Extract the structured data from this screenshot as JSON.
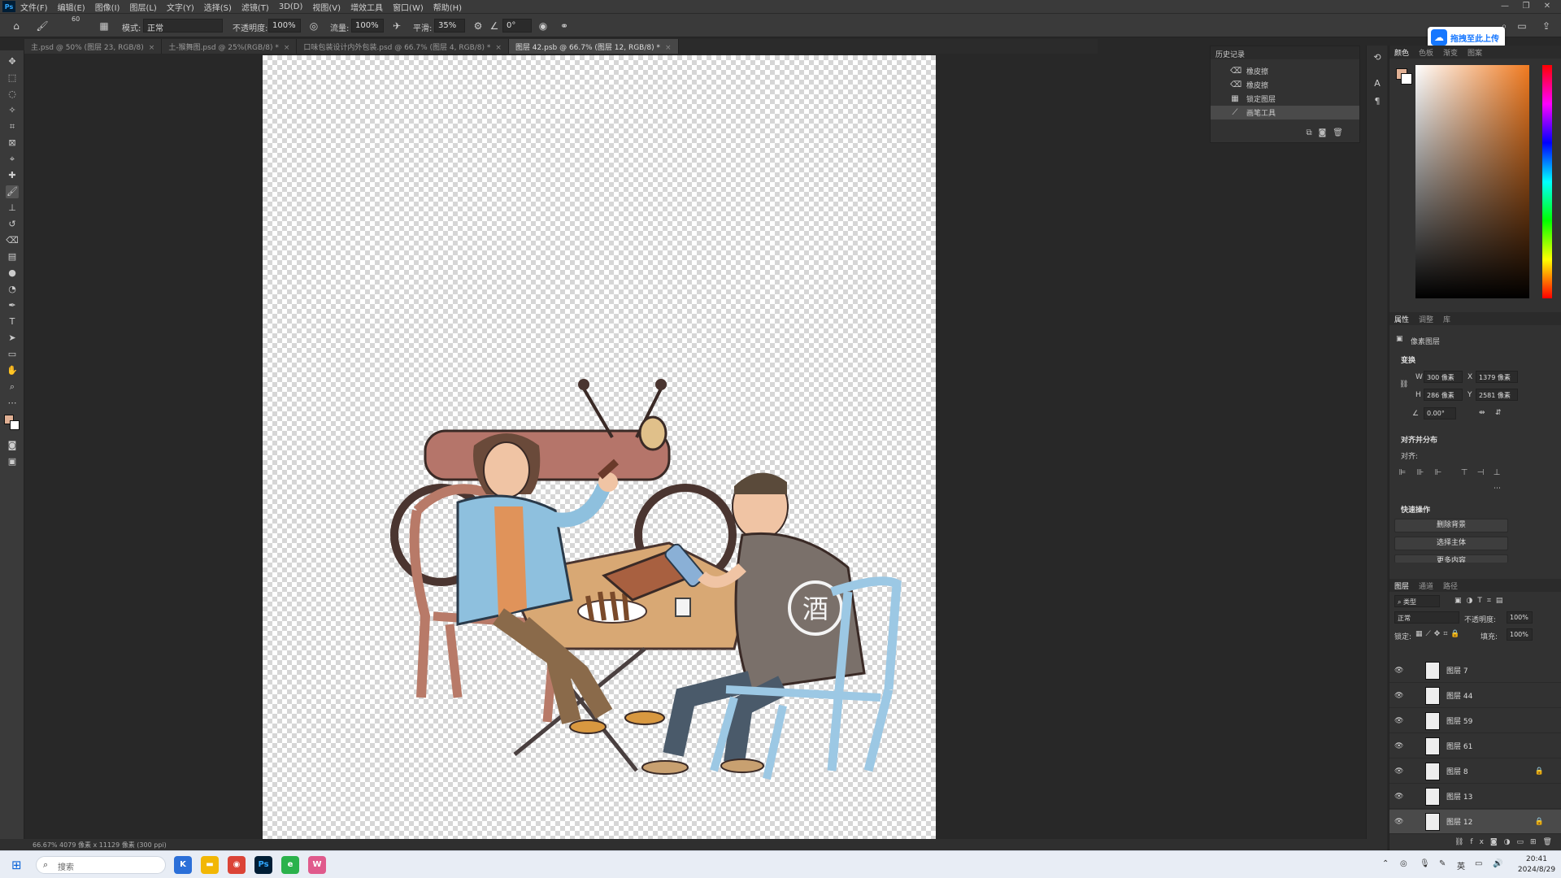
{
  "app": {
    "logo": "Ps",
    "menus": [
      "文件(F)",
      "编辑(E)",
      "图像(I)",
      "图层(L)",
      "文字(Y)",
      "选择(S)",
      "滤镜(T)",
      "3D(D)",
      "视图(V)",
      "增效工具",
      "窗口(W)",
      "帮助(H)"
    ]
  },
  "options": {
    "brush_size": "60",
    "mode_label": "模式:",
    "mode_value": "正常",
    "opacity_label": "不透明度:",
    "opacity_value": "100%",
    "flow_label": "流量:",
    "flow_value": "100%",
    "smooth_label": "平滑:",
    "smooth_value": "35%",
    "angle_value": "0°"
  },
  "upload_badge": {
    "text": "拖拽至此上传",
    "icon": "cloud-upload-icon"
  },
  "tabs": [
    {
      "label": "主.psd @ 50% (图层 23, RGB/8)"
    },
    {
      "label": "土-猴舞图.psd @ 25%(RGB/8) *"
    },
    {
      "label": "口味包装设计内外包装.psd @ 66.7% (图层 4, RGB/8) *"
    },
    {
      "label": "图层 42.psb @ 66.7% (图层 12, RGB/8) *"
    }
  ],
  "history": {
    "title": "历史记录",
    "items": [
      {
        "label": "橡皮擦",
        "icon": "eraser-icon"
      },
      {
        "label": "橡皮擦",
        "icon": "eraser-icon"
      },
      {
        "label": "锁定图层",
        "icon": "lock-layer-icon"
      },
      {
        "label": "画笔工具",
        "icon": "brush-icon"
      }
    ]
  },
  "color_panel": {
    "tabs": [
      "颜色",
      "色板",
      "渐变",
      "图案"
    ],
    "foreground": "#e0b094",
    "background": "#ffffff"
  },
  "properties": {
    "tabs": [
      "属性",
      "调整",
      "库"
    ],
    "layer_type": "像素图层",
    "transform_title": "变换",
    "w_label": "W",
    "w_value": "300 像素",
    "x_label": "X",
    "x_value": "1379 像素",
    "h_label": "H",
    "h_value": "286 像素",
    "y_label": "Y",
    "y_value": "2581 像素",
    "angle_value": "0.00°",
    "align_title": "对齐并分布",
    "align_label": "对齐:",
    "quick_title": "快速操作",
    "quick_actions": [
      "删除背景",
      "选择主体",
      "更多内容"
    ]
  },
  "layers": {
    "tabs": [
      "图层",
      "通道",
      "路径"
    ],
    "filter_label": "类型",
    "blend_mode": "正常",
    "opacity_label": "不透明度:",
    "opacity_value": "100%",
    "lock_label": "锁定:",
    "fill_label": "填充:",
    "fill_value": "100%",
    "items": [
      {
        "name": "图层 7",
        "locked": false
      },
      {
        "name": "图层 44",
        "locked": false
      },
      {
        "name": "图层 59",
        "locked": false
      },
      {
        "name": "图层 61",
        "locked": false
      },
      {
        "name": "图层 8",
        "locked": true
      },
      {
        "name": "图层 13",
        "locked": false
      },
      {
        "name": "图层 12",
        "locked": true,
        "selected": true
      }
    ]
  },
  "status": {
    "text": "66.67%   4079 像素 x 11129 像素 (300 ppi)"
  },
  "taskbar": {
    "search_placeholder": "搜索",
    "time": "20:41",
    "date": "2024/8/29",
    "ime": "英"
  }
}
